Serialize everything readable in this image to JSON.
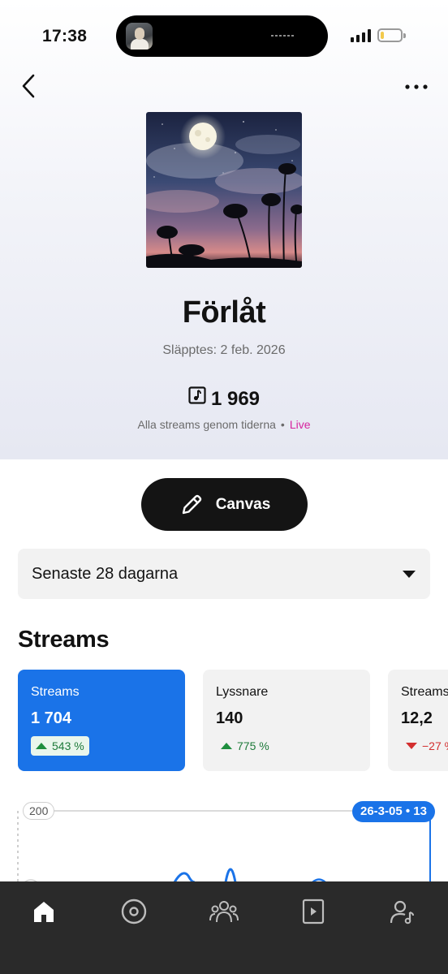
{
  "status_bar": {
    "time": "17:38"
  },
  "release": {
    "title": "Förlåt",
    "released": "Släpptes: 2 feb. 2026",
    "total_streams": "1 969",
    "total_streams_caption": "Alla streams genom tiderna",
    "live_label": "Live"
  },
  "canvas_button": {
    "label": "Canvas"
  },
  "period_select": {
    "value": "Senaste 28 dagarna"
  },
  "section_title": "Streams",
  "stat_cards": [
    {
      "label": "Streams",
      "value": "1 704",
      "delta": "543 %",
      "direction": "up"
    },
    {
      "label": "Lyssnare",
      "value": "140",
      "delta": "775 %",
      "direction": "up"
    },
    {
      "label": "Streams",
      "value": "12,2",
      "delta": "−27 %",
      "direction": "down"
    }
  ],
  "chart": {
    "y_max_label": "200",
    "tooltip": "26-3-05 • 13"
  },
  "colors": {
    "accent": "#1a73e8",
    "live": "#d6249f",
    "up": "#1e8e3e",
    "down": "#d32f2f",
    "nav_bg": "#2a2a2a"
  },
  "bottom_nav": [
    {
      "icon": "home-icon",
      "active": true
    },
    {
      "icon": "disc-icon",
      "active": false
    },
    {
      "icon": "audience-icon",
      "active": false
    },
    {
      "icon": "video-icon",
      "active": false
    },
    {
      "icon": "artist-icon",
      "active": false
    }
  ]
}
